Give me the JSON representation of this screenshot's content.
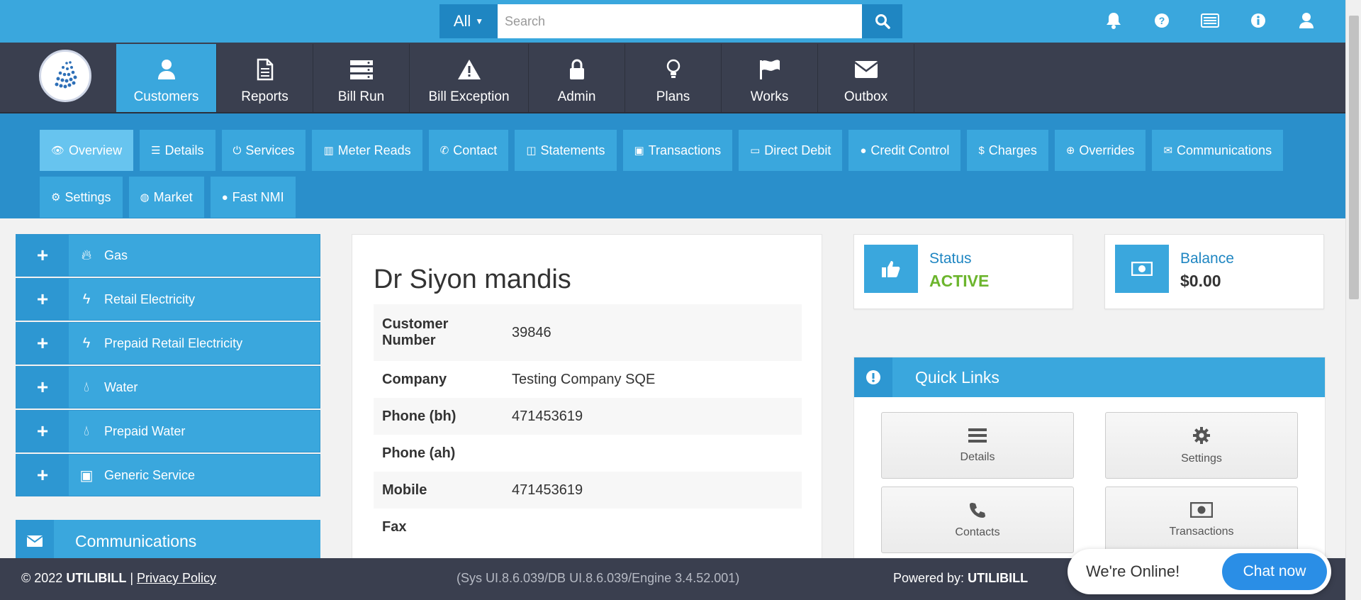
{
  "search": {
    "scope": "All",
    "placeholder": "Search"
  },
  "top_icons": [
    "bell-icon",
    "help-icon",
    "card-icon",
    "info-icon",
    "user-icon"
  ],
  "main_nav": [
    {
      "label": "Customers",
      "icon": "user-icon",
      "active": true
    },
    {
      "label": "Reports",
      "icon": "document-icon"
    },
    {
      "label": "Bill Run",
      "icon": "server-icon"
    },
    {
      "label": "Bill Exception",
      "icon": "warning-icon"
    },
    {
      "label": "Admin",
      "icon": "lock-icon"
    },
    {
      "label": "Plans",
      "icon": "lightbulb-icon"
    },
    {
      "label": "Works",
      "icon": "flag-icon"
    },
    {
      "label": "Outbox",
      "icon": "envelope-icon"
    }
  ],
  "sub_nav": [
    {
      "label": "Overview",
      "icon": "eye-icon",
      "active": true
    },
    {
      "label": "Details",
      "icon": "list-icon"
    },
    {
      "label": "Services",
      "icon": "power-icon"
    },
    {
      "label": "Meter Reads",
      "icon": "bar-chart-icon"
    },
    {
      "label": "Contact",
      "icon": "phone-icon"
    },
    {
      "label": "Statements",
      "icon": "columns-icon"
    },
    {
      "label": "Transactions",
      "icon": "money-icon"
    },
    {
      "label": "Direct Debit",
      "icon": "credit-card-icon"
    },
    {
      "label": "Credit Control",
      "icon": "user-icon"
    },
    {
      "label": "Charges",
      "icon": "dollar-icon"
    },
    {
      "label": "Overrides",
      "icon": "circle-arrow-icon"
    },
    {
      "label": "Communications",
      "icon": "envelope-icon"
    },
    {
      "label": "Settings",
      "icon": "gear-icon"
    },
    {
      "label": "Market",
      "icon": "globe-icon"
    },
    {
      "label": "Fast NMI",
      "icon": "user-icon"
    }
  ],
  "services": [
    {
      "label": "Gas",
      "icon": "fire-icon"
    },
    {
      "label": "Retail Electricity",
      "icon": "bolt-icon"
    },
    {
      "label": "Prepaid Retail Electricity",
      "icon": "bolt-icon"
    },
    {
      "label": "Water",
      "icon": "drop-icon"
    },
    {
      "label": "Prepaid Water",
      "icon": "drop-icon"
    },
    {
      "label": "Generic Service",
      "icon": "money-icon"
    }
  ],
  "communications_panel": {
    "label": "Communications"
  },
  "customer": {
    "name": "Dr Siyon mandis",
    "fields": [
      {
        "label": "Customer Number",
        "value": "39846"
      },
      {
        "label": "Company",
        "value": "Testing Company SQE"
      },
      {
        "label": "Phone (bh)",
        "value": "471453619"
      },
      {
        "label": "Phone (ah)",
        "value": ""
      },
      {
        "label": "Mobile",
        "value": "471453619"
      },
      {
        "label": "Fax",
        "value": ""
      }
    ]
  },
  "status": {
    "title": "Status",
    "value": "ACTIVE",
    "color": "#6cb52d"
  },
  "balance": {
    "title": "Balance",
    "value": "$0.00"
  },
  "quick_links": {
    "title": "Quick Links",
    "items": [
      {
        "label": "Details",
        "icon": "list-icon"
      },
      {
        "label": "Settings",
        "icon": "gear-icon"
      },
      {
        "label": "Contacts",
        "icon": "phone-icon"
      },
      {
        "label": "Transactions",
        "icon": "money-icon"
      }
    ]
  },
  "footer": {
    "copyright_prefix": "© 2022",
    "brand": "UTILIBILL",
    "separator": "|",
    "privacy": "Privacy Policy",
    "version": "(Sys UI.8.6.039/DB UI.8.6.039/Engine 3.4.52.001)",
    "powered_prefix": "Powered by:",
    "powered_brand": "UTILIBILL"
  },
  "chat": {
    "status": "We're Online!",
    "button": "Chat now"
  },
  "colors": {
    "accent": "#3aa7dd",
    "accent_dark": "#2a8fcb",
    "nav_bg": "#3a3f4f",
    "active_green": "#6cb52d"
  }
}
